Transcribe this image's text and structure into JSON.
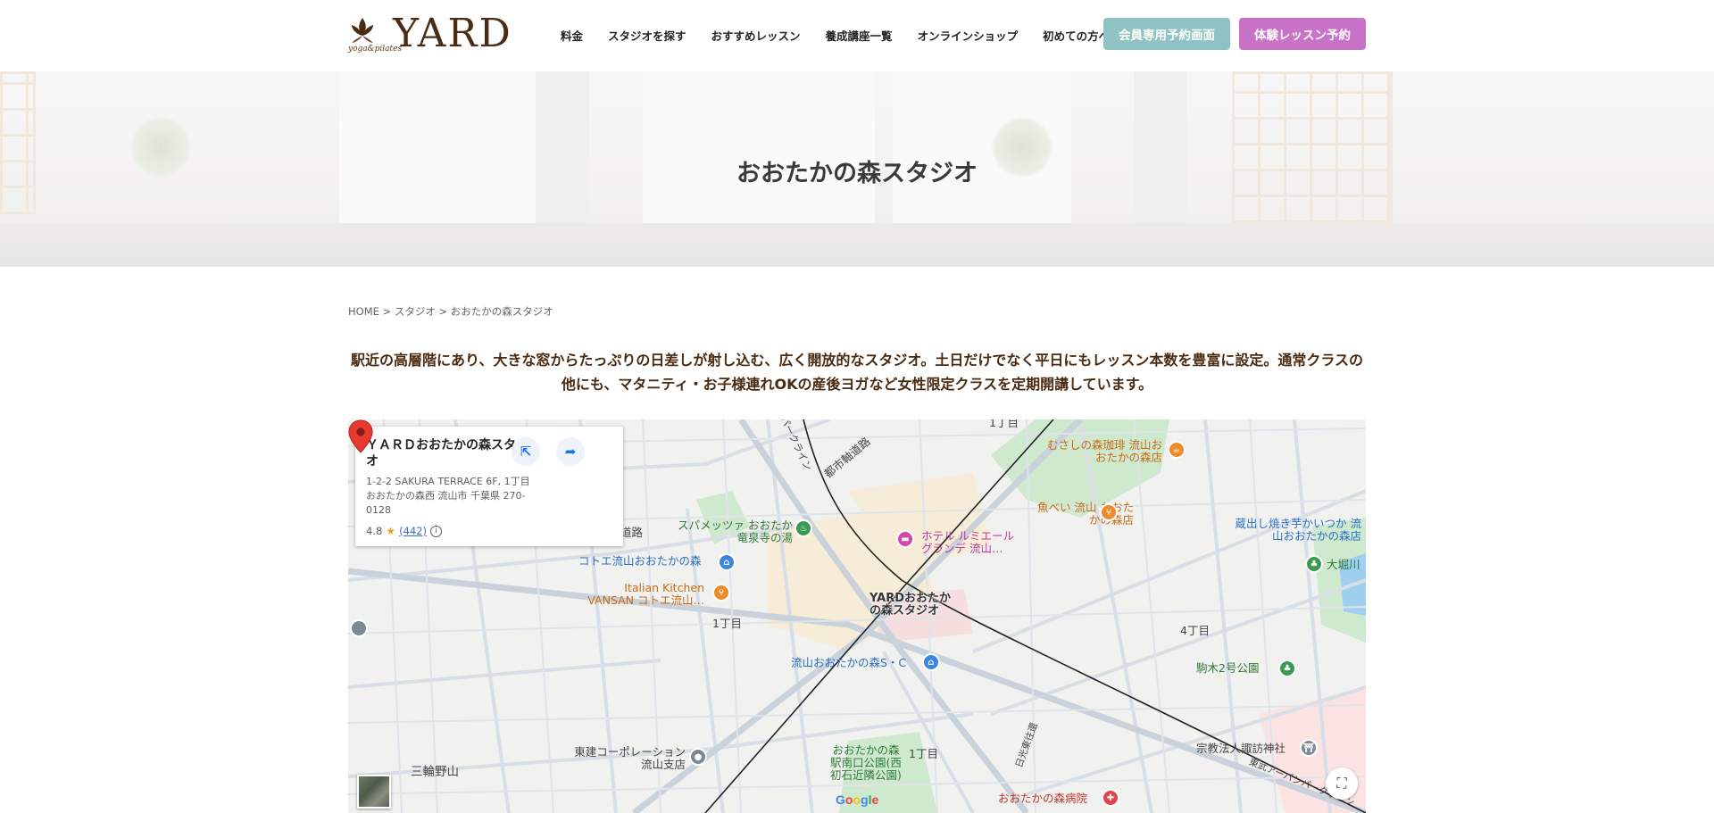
{
  "header": {
    "logo_small": "yoga&pilates",
    "logo_text": "YARD",
    "nav": [
      "料金",
      "スタジオを探す",
      "おすすめレッスン",
      "養成講座一覧",
      "オンラインショップ",
      "初めての方へ"
    ],
    "member_button": "会員専用予約画面",
    "trial_button": "体験レッスン予約"
  },
  "hero": {
    "title": "おおたかの森スタジオ"
  },
  "breadcrumb": {
    "home": "HOME",
    "sep1": " > ",
    "studio": "スタジオ",
    "sep2": " > ",
    "current": "おおたかの森スタジオ"
  },
  "description": "駅近の高層階にあり、大きな窓からたっぷりの日差しが射し込む、広く開放的なスタジオ。土日だけでなく平日にもレッスン本数を豊富に設定。通常クラスの他にも、マタニティ・お子様連れOKの産後ヨガなど女性限定クラスを定期開講しています。",
  "map": {
    "card": {
      "title": "ＹＡＲＤおおたかの森スタジオ",
      "address": "1-2-2 SAKURA TERRACE 6F, 1丁目 おおたかの森西 流山市 千葉県 270-0128",
      "rating": "4.8",
      "reviews": "(442)"
    },
    "marker_label": "YARDおおたかの森スタジオ",
    "labels": {
      "chome1_top": "1丁目",
      "road_city": "都市軸道路",
      "road_park": "パークライン",
      "road_small": "道路",
      "musashi": "むさしの森珈琲 流山おおたかの森店",
      "sopa": "スパメッツァ おおたか 竜泉寺の湯",
      "hotel": "ホテル ルミエール グランデ 流山…",
      "uobei": "魚べい 流山 おおたかの森店",
      "kurade": "蔵出し焼き芋かいつか 流山おおたかの森店",
      "ohorikawa": "大堀川",
      "kotoe": "コトエ流山おおたかの森",
      "italian": "Italian Kitchen VANSAN コトエ流山…",
      "chome1_mid": "1丁目",
      "chome4": "4丁目",
      "komagi": "駒木2号公園",
      "sc": "流山おおたかの森S・C",
      "touken": "東建コーポレーション 流山支店",
      "park": "おおたかの森駅南口公園(西初石近隣公園)",
      "chome1_bot": "1丁目",
      "suwa": "宗教法人諏訪神社",
      "miwa": "三輪野山",
      "hospital": "おおたかの森病院",
      "tobu": "東武アーバンパークライン",
      "nisshin": "日光東往還"
    },
    "google": [
      "G",
      "o",
      "o",
      "g",
      "l",
      "e"
    ]
  }
}
